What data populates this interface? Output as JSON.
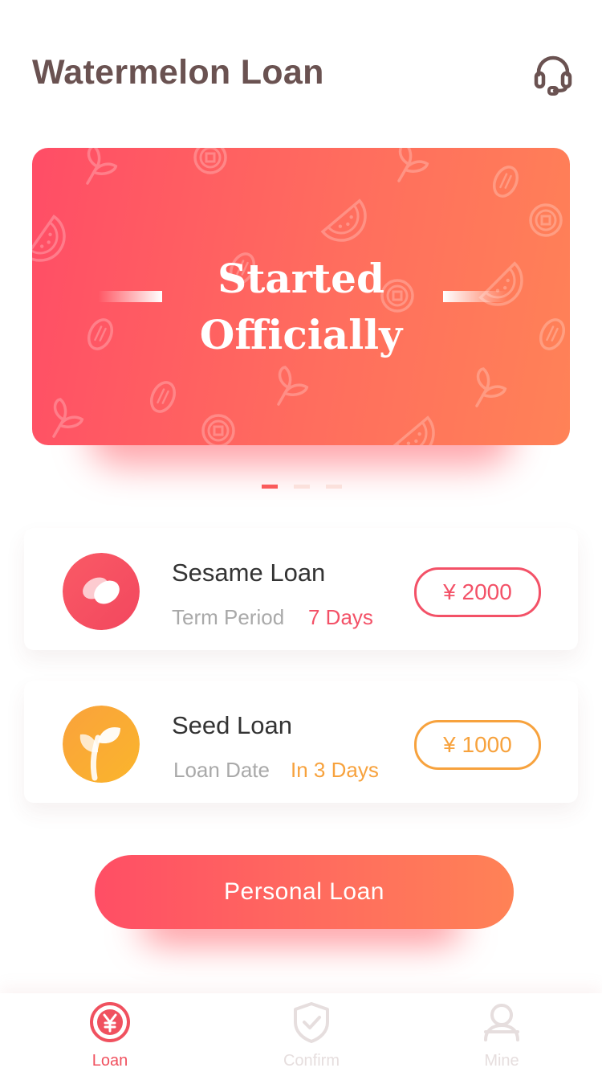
{
  "header": {
    "title": "Watermelon Loan",
    "support_icon": "headset-icon"
  },
  "banner": {
    "line1": "Started",
    "line2": "Officially",
    "pattern_icons": [
      "watermelon-icon",
      "seed-icon",
      "sprout-icon",
      "coin-icon"
    ],
    "colors": {
      "start": "#ff4d66",
      "end": "#ff8257"
    }
  },
  "carousel": {
    "count": 3,
    "active_index": 0
  },
  "loans": [
    {
      "name": "Sesame Loan",
      "meta_label": "Term Period",
      "meta_value": "7 Days",
      "amount": "¥ 2000",
      "icon": "sesame-icon",
      "accent": "#f35167"
    },
    {
      "name": "Seed Loan",
      "meta_label": "Loan Date",
      "meta_value": "In 3 Days",
      "amount": "¥ 1000",
      "icon": "sprout-icon",
      "accent": "#f7a23d"
    }
  ],
  "cta": {
    "label": "Personal Loan"
  },
  "tabbar": {
    "tabs": [
      {
        "label": "Loan",
        "icon": "yen-coin-icon",
        "active": true
      },
      {
        "label": "Confirm",
        "icon": "shield-check-icon",
        "active": false
      },
      {
        "label": "Mine",
        "icon": "user-icon",
        "active": false
      }
    ],
    "active_color": "#f0515f",
    "inactive_color": "#e6dede"
  }
}
